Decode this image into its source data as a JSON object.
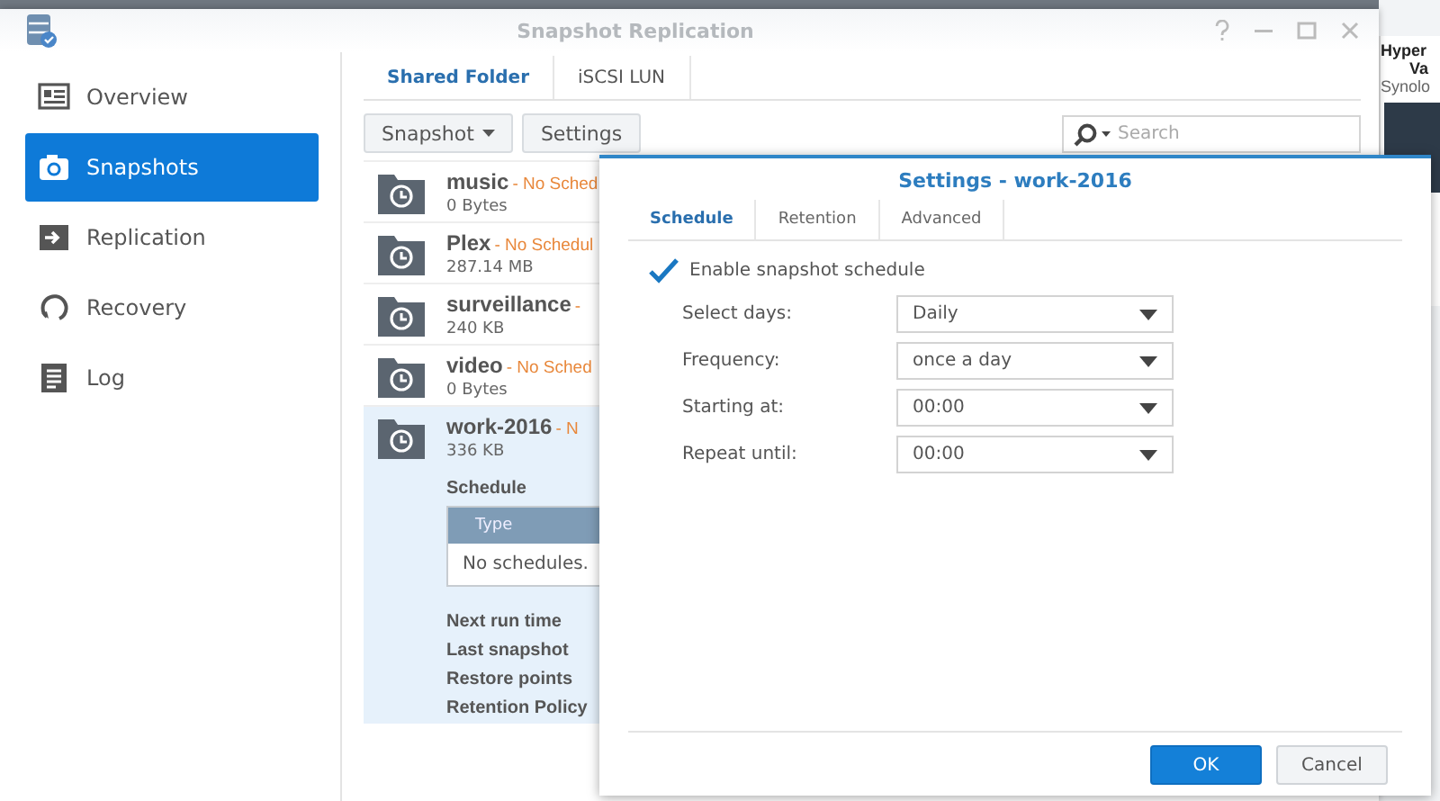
{
  "window": {
    "title": "Snapshot Replication"
  },
  "sidebar": {
    "items": [
      {
        "label": "Overview",
        "selected": false
      },
      {
        "label": "Snapshots",
        "selected": true
      },
      {
        "label": "Replication",
        "selected": false
      },
      {
        "label": "Recovery",
        "selected": false
      },
      {
        "label": "Log",
        "selected": false
      }
    ]
  },
  "tabs": [
    {
      "label": "Shared Folder",
      "selected": true
    },
    {
      "label": "iSCSI LUN",
      "selected": false
    }
  ],
  "toolbar": {
    "buttons": [
      {
        "label": "Snapshot",
        "kind": "menu"
      },
      {
        "label": "Settings",
        "kind": "plain"
      }
    ],
    "search": {
      "placeholder": "Search"
    }
  },
  "folders": [
    {
      "name": "music",
      "status": "- No Sched",
      "size": "0 Bytes",
      "expanded": false
    },
    {
      "name": "Plex",
      "status": "- No Schedul",
      "size": "287.14 MB",
      "expanded": false
    },
    {
      "name": "surveillance",
      "status": "-",
      "size": "240 KB",
      "expanded": false
    },
    {
      "name": "video",
      "status": "- No Sched",
      "size": "0 Bytes",
      "expanded": false
    },
    {
      "name": "work-2016",
      "status": "- N",
      "size": "336 KB",
      "expanded": true
    }
  ],
  "details": {
    "schedule_label": "Schedule",
    "table": {
      "columns": [
        "Type"
      ],
      "empty": "No schedules."
    },
    "fields": [
      "Next run time",
      "Last snapshot",
      "Restore points",
      "Retention Policy"
    ]
  },
  "dialog": {
    "title": "Settings - work-2016",
    "tabs": [
      {
        "label": "Schedule",
        "selected": true
      },
      {
        "label": "Retention",
        "selected": false
      },
      {
        "label": "Advanced",
        "selected": false
      }
    ],
    "enable": {
      "label": "Enable snapshot schedule",
      "checked": true
    },
    "fields": [
      {
        "label": "Select days:",
        "value": "Daily"
      },
      {
        "label": "Frequency:",
        "value": "once a day"
      },
      {
        "label": "Starting at:",
        "value": "00:00"
      },
      {
        "label": "Repeat until:",
        "value": "00:00"
      }
    ],
    "buttons": [
      {
        "label": "OK",
        "kind": "primary"
      },
      {
        "label": "Cancel",
        "kind": "secondary"
      }
    ]
  },
  "widget": {
    "title_1": "Hyper",
    "title_2": "Va",
    "subtitle": "Synolo"
  }
}
